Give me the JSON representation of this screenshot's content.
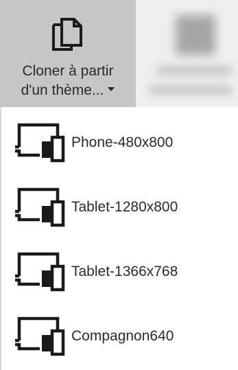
{
  "ribbon": {
    "clone_button": {
      "label_line1": "Cloner à partir",
      "label_line2": "d'un thème...",
      "icon": "copy-pages-icon"
    },
    "blurred_button": {
      "icon": "blurred-icon"
    }
  },
  "menu": {
    "items": [
      {
        "label": "Phone-480x800",
        "icon": "devices-icon"
      },
      {
        "label": "Tablet-1280x800",
        "icon": "devices-icon"
      },
      {
        "label": "Tablet-1366x768",
        "icon": "devices-icon"
      },
      {
        "label": "Compagnon640",
        "icon": "devices-icon"
      }
    ]
  },
  "colors": {
    "selected_button_bg": "#c6c6c6",
    "ribbon_bg": "#f3f3f3",
    "text": "#2b2b2b",
    "icon_stroke": "#1a1a1a"
  }
}
